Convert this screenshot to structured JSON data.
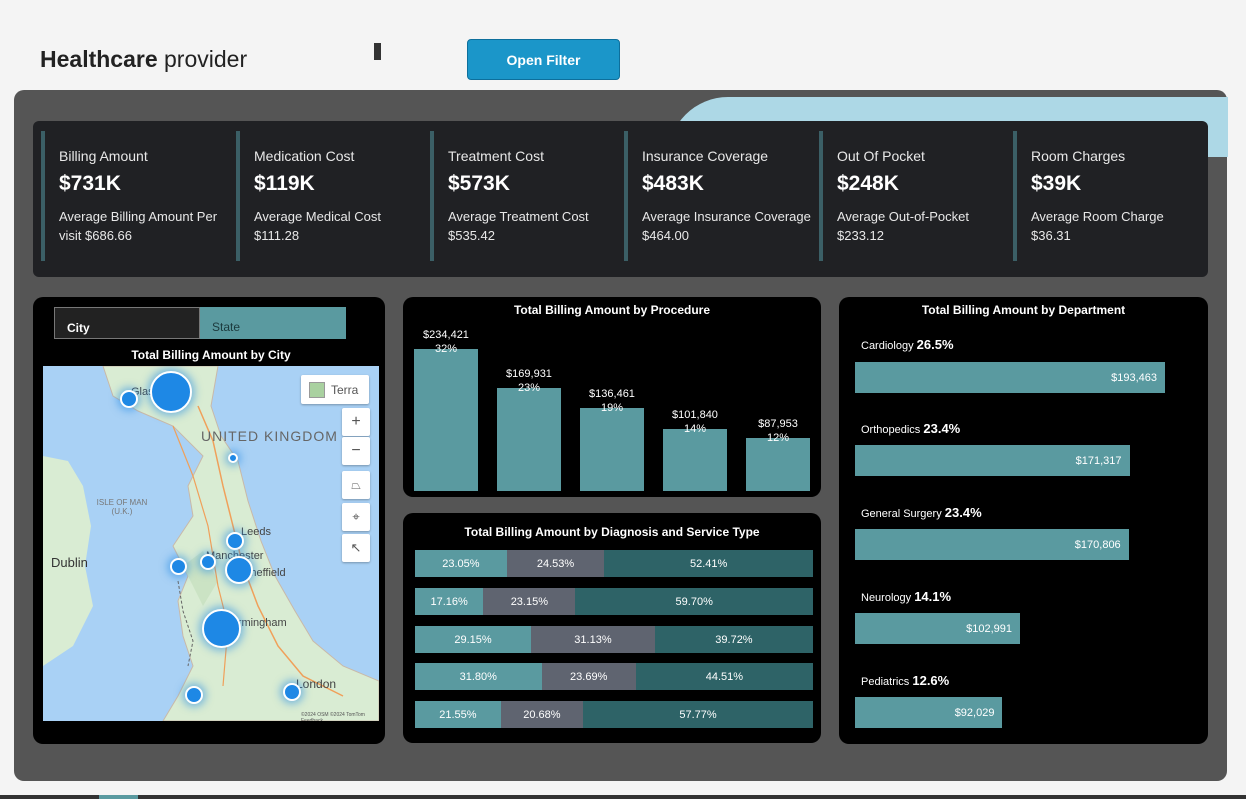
{
  "header": {
    "title_bold": "Healthcare",
    "title_rest": " provider",
    "open_filter": "Open Filter"
  },
  "kpis": [
    {
      "label": "Billing Amount",
      "value": "$731K",
      "sub": "Average Billing Amount Per visit $686.66"
    },
    {
      "label": "Medication Cost",
      "value": "$119K",
      "sub": "Average Medical Cost $111.28"
    },
    {
      "label": "Treatment Cost",
      "value": "$573K",
      "sub": "Average Treatment Cost $535.42"
    },
    {
      "label": "Insurance Coverage",
      "value": "$483K",
      "sub": "Average Insurance Coverage $464.00"
    },
    {
      "label": "Out Of Pocket",
      "value": "$248K",
      "sub": "Average Out-of-Pocket $233.12"
    },
    {
      "label": "Room Charges",
      "value": "$39K",
      "sub": "Average Room Charge $36.31"
    }
  ],
  "map_panel": {
    "tabs": [
      "City",
      "State"
    ],
    "title": "Total Billing Amount by City",
    "style_button": "Terra",
    "labels": {
      "country": "UNITED KINGDOM",
      "isle": "ISLE OF MAN (U.K.)",
      "dublin": "Dublin",
      "leeds": "Leeds",
      "manchester": "Manchester",
      "sheffield": "Sheffield",
      "birmingham": "Birmingham",
      "london": "London",
      "glasgow": "Glasgow",
      "attribution": "©2024 OSM ©2024 TomTom Feedback"
    }
  },
  "chart_data": [
    {
      "type": "bar",
      "title": "Total Billing Amount by Procedure",
      "categories": [
        "",
        "",
        "",
        "",
        ""
      ],
      "values": [
        234421,
        169931,
        136461,
        101840,
        87953
      ],
      "value_labels": [
        "$234,421",
        "$169,931",
        "$136,461",
        "$101,840",
        "$87,953"
      ],
      "pct_labels": [
        "32%",
        "23%",
        "19%",
        "14%",
        "12%"
      ]
    },
    {
      "type": "bar",
      "orientation": "horizontal-stacked-100",
      "title": "Total Billing Amount by Diagnosis and Service Type",
      "rows": [
        [
          23.05,
          24.53,
          52.41
        ],
        [
          17.16,
          23.15,
          59.7
        ],
        [
          29.15,
          31.13,
          39.72
        ],
        [
          31.8,
          23.69,
          44.51
        ],
        [
          21.55,
          20.68,
          57.77
        ]
      ],
      "row_labels": [
        [
          "23.05%",
          "24.53%",
          "52.41%"
        ],
        [
          "17.16%",
          "23.15%",
          "59.70%"
        ],
        [
          "29.15%",
          "31.13%",
          "39.72%"
        ],
        [
          "31.80%",
          "23.69%",
          "44.51%"
        ],
        [
          "21.55%",
          "20.68%",
          "57.77%"
        ]
      ],
      "colors": [
        "#5a9aa0",
        "#5f6470",
        "#2e6367"
      ]
    },
    {
      "type": "bar",
      "orientation": "horizontal",
      "title": "Total Billing Amount by Department",
      "categories": [
        "Cardiology",
        "Orthopedics",
        "General Surgery",
        "Neurology",
        "Pediatrics"
      ],
      "pcts": [
        "26.5%",
        "23.4%",
        "23.4%",
        "14.1%",
        "12.6%"
      ],
      "values": [
        193463,
        171317,
        170806,
        102991,
        92029
      ],
      "value_labels": [
        "$193,463",
        "$171,317",
        "$170,806",
        "$102,991",
        "$92,029"
      ]
    }
  ]
}
